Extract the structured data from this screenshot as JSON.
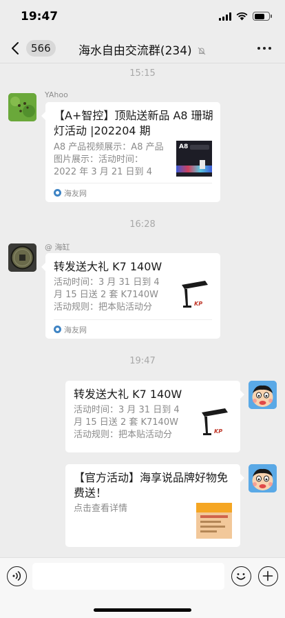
{
  "status": {
    "time": "19:47"
  },
  "nav": {
    "back_count": "566",
    "title": "海水自由交流群(234)"
  },
  "messages": [
    {
      "time": "15:15",
      "sender": "YAhoo",
      "title": "【A+智控】顶贴送新品 A8 珊瑚灯活动 |202204 期",
      "desc": "A8 产品视频展示：A8 产品图片展示：活动时间：2022 年 3 月 21 日到 4 月 2...",
      "source": "海友网",
      "thumb_text": "A8"
    },
    {
      "time": "16:28",
      "sender": "@ 海缸",
      "title": "转发送大礼 K7 140W",
      "desc": "活动时间：3 月 31 日到 4 月 15 日送 2 套 K7140W 活动规则：把本贴活动分享...",
      "source": "海友网"
    },
    {
      "time": "19:47",
      "title": "转发送大礼 K7 140W",
      "desc": "活动时间：3 月 31 日到 4 月 15 日送 2 套 K7140W 活动规则：把本贴活动分享..."
    },
    {
      "title": "【官方活动】海享说品牌好物免费送！",
      "desc": "点击查看详情"
    }
  ],
  "icons": {
    "back": "chevron-left-icon",
    "mute": "bell-off-icon",
    "more": "more-dots-icon",
    "voice": "voice-icon",
    "emoji": "emoji-icon",
    "plus": "plus-icon",
    "source": "site-logo-icon"
  },
  "colors": {
    "background": "#ededed",
    "bubble": "#ffffff",
    "muted_text": "#8a8a8a",
    "timestamp": "#a8a8a8"
  }
}
